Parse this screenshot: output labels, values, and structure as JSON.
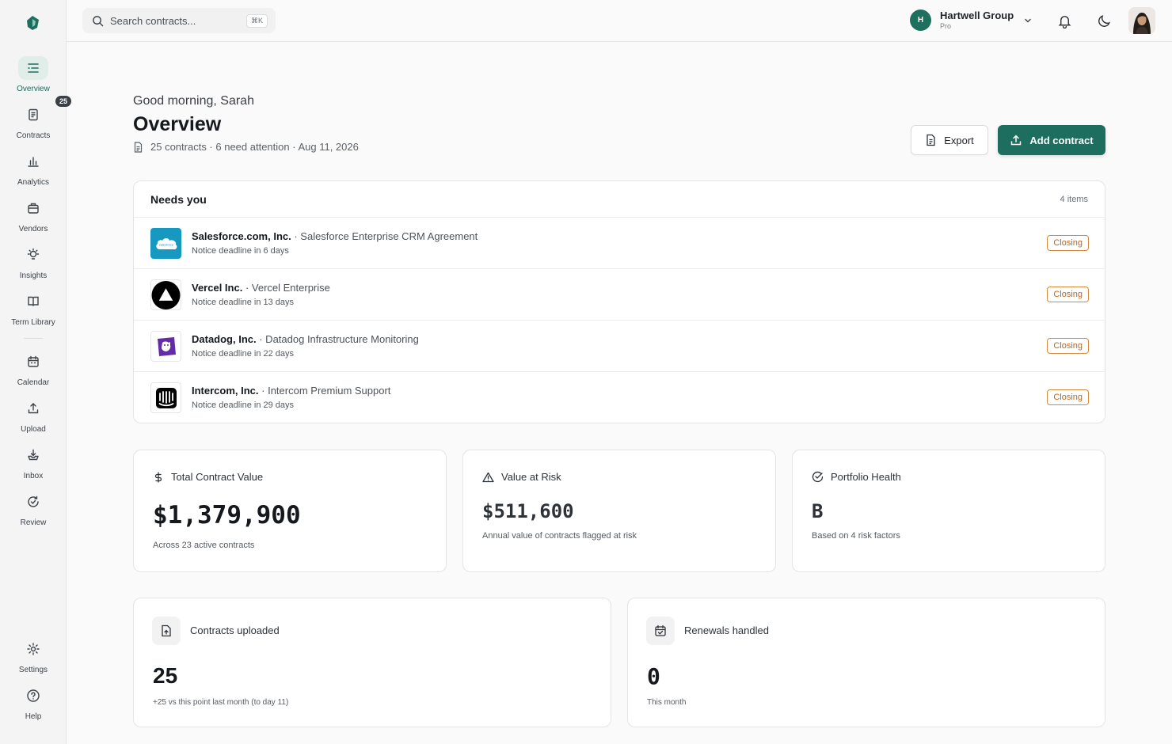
{
  "sidebar": {
    "items": [
      {
        "label": "Overview",
        "icon": "list-icon",
        "active": true
      },
      {
        "label": "Contracts",
        "icon": "document-icon",
        "badge": "25"
      },
      {
        "label": "Analytics",
        "icon": "bar-chart-icon"
      },
      {
        "label": "Vendors",
        "icon": "briefcase-icon"
      },
      {
        "label": "Insights",
        "icon": "lightbulb-icon"
      },
      {
        "label": "Term Library",
        "icon": "book-icon"
      },
      {
        "label": "Calendar",
        "icon": "calendar-icon"
      },
      {
        "label": "Upload",
        "icon": "upload-icon"
      },
      {
        "label": "Inbox",
        "icon": "inbox-icon"
      },
      {
        "label": "Review",
        "icon": "refresh-check-icon"
      },
      {
        "label": "Settings",
        "icon": "gear-icon"
      },
      {
        "label": "Help",
        "icon": "help-icon"
      }
    ]
  },
  "topbar": {
    "search_placeholder": "Search contracts...",
    "search_shortcut": "⌘K",
    "org_initial": "H",
    "org_name": "Hartwell Group",
    "org_plan": "Pro"
  },
  "header": {
    "greeting": "Good morning, Sarah",
    "title": "Overview",
    "meta": "25 contracts · 6 need attention · Aug 11, 2026",
    "export_label": "Export",
    "add_label": "Add contract"
  },
  "needs_you": {
    "title": "Needs you",
    "count": "4 items",
    "rows": [
      {
        "company": "Salesforce.com, Inc.",
        "contract": " · Salesforce Enterprise CRM Agreement",
        "deadline": "Notice deadline in 6 days",
        "status": "Closing",
        "logo_text": "salesforce"
      },
      {
        "company": "Vercel Inc.",
        "contract": " · Vercel Enterprise",
        "deadline": "Notice deadline in 13 days",
        "status": "Closing"
      },
      {
        "company": "Datadog, Inc.",
        "contract": " · Datadog Infrastructure Monitoring",
        "deadline": "Notice deadline in 22 days",
        "status": "Closing"
      },
      {
        "company": "Intercom, Inc.",
        "contract": " · Intercom Premium Support",
        "deadline": "Notice deadline in 29 days",
        "status": "Closing"
      }
    ]
  },
  "stats": {
    "total_value": {
      "label": "Total Contract Value",
      "value": "$1,379,900",
      "sub": "Across 23 active contracts"
    },
    "value_at_risk": {
      "label": "Value at Risk",
      "value": "$511,600",
      "sub": "Annual value of contracts flagged at risk"
    },
    "portfolio_health": {
      "label": "Portfolio Health",
      "value": "B",
      "sub": "Based on 4 risk factors"
    }
  },
  "tiles": {
    "uploaded": {
      "label": "Contracts uploaded",
      "value": "25",
      "sub": "+25 vs this point last month (to day 11)"
    },
    "renewals": {
      "label": "Renewals handled",
      "value": "0",
      "sub": "This month"
    }
  },
  "colors": {
    "accent": "#1d6e5f",
    "badge_orange": "#c0661a",
    "active_nav_bg": "#e1ede9"
  }
}
